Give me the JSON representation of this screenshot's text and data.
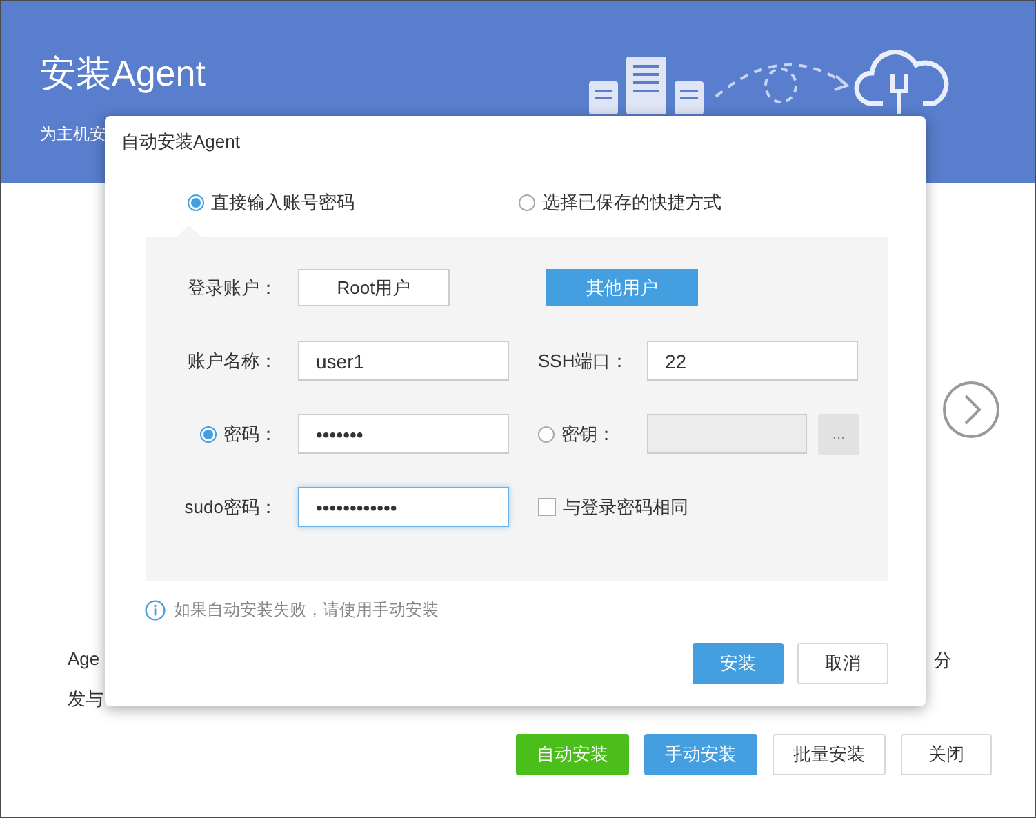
{
  "page": {
    "title": "安装Agent",
    "subtitle": "为主机安",
    "description_left": "Age",
    "description_right": "分",
    "description_line2": "发与"
  },
  "actions": [
    {
      "label": "自动安装",
      "kind": "success"
    },
    {
      "label": "手动安装",
      "kind": "primary"
    },
    {
      "label": "批量安装",
      "kind": "default"
    },
    {
      "label": "关闭",
      "kind": "default"
    }
  ],
  "dialog": {
    "title": "自动安装Agent",
    "modes": [
      {
        "label": "直接输入账号密码",
        "selected": true
      },
      {
        "label": "选择已保存的快捷方式",
        "selected": false
      }
    ],
    "login_account": {
      "label": "登录账户：",
      "options": [
        {
          "label": "Root用户",
          "selected": false
        },
        {
          "label": "其他用户",
          "selected": true
        }
      ]
    },
    "account_name": {
      "label": "账户名称：",
      "value": "user1"
    },
    "ssh_port": {
      "label": "SSH端口：",
      "value": "22"
    },
    "auth": [
      {
        "label": "密码：",
        "selected": true,
        "disabled": false,
        "value": "•••••••"
      },
      {
        "label": "密钥：",
        "selected": false,
        "disabled": true,
        "browse": "..."
      }
    ],
    "sudo_password": {
      "label": "sudo密码：",
      "value": "••••••••••••",
      "focused": true
    },
    "same_as_login": {
      "label": "与登录密码相同",
      "checked": false
    },
    "hint": "如果自动安装失败，请使用手动安装",
    "buttons": [
      {
        "label": "安装",
        "kind": "primary"
      },
      {
        "label": "取消",
        "kind": "default"
      }
    ]
  }
}
